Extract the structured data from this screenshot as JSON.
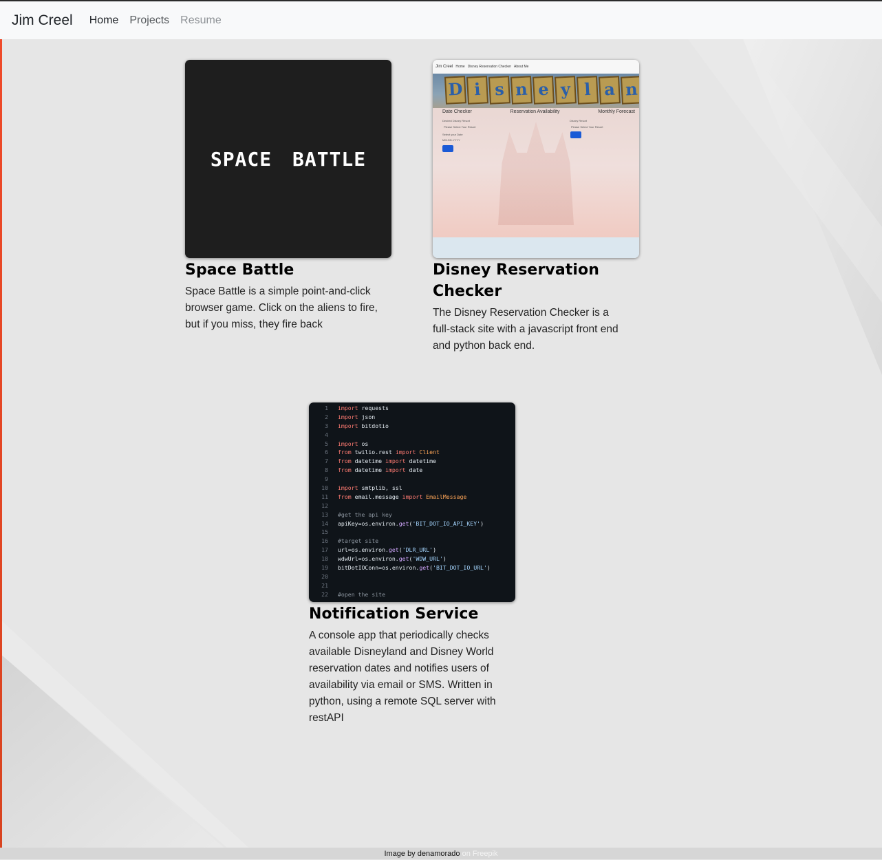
{
  "nav": {
    "brand": "Jim Creel",
    "links": [
      {
        "label": "Home"
      },
      {
        "label": "Projects"
      },
      {
        "label": "Resume"
      }
    ]
  },
  "projects": [
    {
      "title": "Space Battle",
      "description": "Space Battle is a simple point-and-click browser game. Click on the aliens to fire, but if you miss, they fire back",
      "thumb_text": "SPACE BATTLE"
    },
    {
      "title": "Disney Reservation Checker",
      "description": "The Disney Reservation Checker is a full-stack site with a javascript front end and python back end.",
      "thumb": {
        "nav_brand": "Jim Creel",
        "nav_links": [
          "Home",
          "Disney Reservation Checker",
          "About Me"
        ],
        "banner": "Disneyland",
        "columns": [
          "Date Checker",
          "Reservation Availability",
          "Monthly Forecast"
        ],
        "field1_label": "Desired Disney Resort",
        "field1_value": "Please Select Your Resort",
        "field2_label": "Select your Date",
        "field2_value": "MM-DD-YYYY",
        "field3_label": "Disney Resort",
        "field3_value": "Please Select Your Resort",
        "submit": "Submit"
      }
    },
    {
      "title": "Notification Service",
      "description": "A console app that periodically checks available Disneyland and Disney World reservation dates and notifies users of availability via email or SMS. Written in python, using a remote SQL server with restAPI"
    }
  ],
  "code_lines": [
    {
      "n": "1",
      "parts": [
        [
          "kw",
          "import"
        ],
        [
          "tx",
          " requests"
        ]
      ]
    },
    {
      "n": "2",
      "parts": [
        [
          "kw",
          "import"
        ],
        [
          "tx",
          " json"
        ]
      ]
    },
    {
      "n": "3",
      "parts": [
        [
          "kw",
          "import"
        ],
        [
          "tx",
          " bitdotio"
        ]
      ]
    },
    {
      "n": "4",
      "parts": []
    },
    {
      "n": "5",
      "parts": [
        [
          "kw",
          "import"
        ],
        [
          "tx",
          " os"
        ]
      ]
    },
    {
      "n": "6",
      "parts": [
        [
          "kw",
          "from"
        ],
        [
          "tx",
          " twilio.rest "
        ],
        [
          "kw",
          "import"
        ],
        [
          "cls",
          " Client"
        ]
      ]
    },
    {
      "n": "7",
      "parts": [
        [
          "kw",
          "from"
        ],
        [
          "tx",
          " datetime "
        ],
        [
          "kw",
          "import"
        ],
        [
          "tx",
          " datetime"
        ]
      ]
    },
    {
      "n": "8",
      "parts": [
        [
          "kw",
          "from"
        ],
        [
          "tx",
          " datetime "
        ],
        [
          "kw",
          "import"
        ],
        [
          "tx",
          " date"
        ]
      ]
    },
    {
      "n": "9",
      "parts": []
    },
    {
      "n": "10",
      "parts": [
        [
          "kw",
          "import"
        ],
        [
          "tx",
          " smtplib, ssl"
        ]
      ]
    },
    {
      "n": "11",
      "parts": [
        [
          "kw",
          "from"
        ],
        [
          "tx",
          " email.message "
        ],
        [
          "kw",
          "import"
        ],
        [
          "cls",
          " EmailMessage"
        ]
      ]
    },
    {
      "n": "12",
      "parts": []
    },
    {
      "n": "13",
      "parts": [
        [
          "cm",
          "#get the api key"
        ]
      ]
    },
    {
      "n": "14",
      "parts": [
        [
          "tx",
          "apiKey=os.environ."
        ],
        [
          "fn",
          "get"
        ],
        [
          "tx",
          "("
        ],
        [
          "str",
          "'BIT_DOT_IO_API_KEY'"
        ],
        [
          "tx",
          ")"
        ]
      ]
    },
    {
      "n": "15",
      "parts": []
    },
    {
      "n": "16",
      "parts": [
        [
          "cm",
          "#target site"
        ]
      ]
    },
    {
      "n": "17",
      "parts": [
        [
          "tx",
          "url=os.environ."
        ],
        [
          "fn",
          "get"
        ],
        [
          "tx",
          "("
        ],
        [
          "str",
          "'DLR_URL'"
        ],
        [
          "tx",
          ")"
        ]
      ]
    },
    {
      "n": "18",
      "parts": [
        [
          "tx",
          "wdwUrl=os.environ."
        ],
        [
          "fn",
          "get"
        ],
        [
          "tx",
          "("
        ],
        [
          "str",
          "'WDW_URL'"
        ],
        [
          "tx",
          ")"
        ]
      ]
    },
    {
      "n": "19",
      "parts": [
        [
          "tx",
          "bitDotIOConn=os.environ."
        ],
        [
          "fn",
          "get"
        ],
        [
          "tx",
          "("
        ],
        [
          "str",
          "'BIT_DOT_IO_URL'"
        ],
        [
          "tx",
          ")"
        ]
      ]
    },
    {
      "n": "20",
      "parts": []
    },
    {
      "n": "21",
      "parts": []
    },
    {
      "n": "22",
      "parts": [
        [
          "cm",
          "#open the site"
        ]
      ]
    }
  ],
  "footer": {
    "text": "Image by denamorado",
    "link": "on Freepik"
  }
}
